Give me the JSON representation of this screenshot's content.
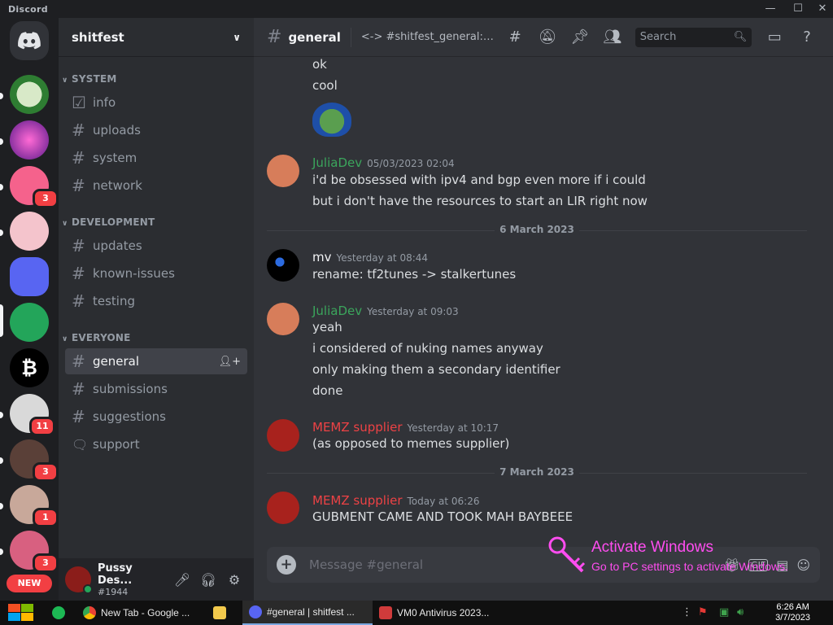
{
  "app": {
    "brand": "Discord"
  },
  "window_controls": {
    "minimize": "—",
    "maximize": "☐",
    "close": "✕"
  },
  "servers": {
    "badges": [
      {
        "server": "server-3",
        "count": "3"
      },
      {
        "server": "server-8",
        "count": "11"
      },
      {
        "server": "server-9",
        "count": "3"
      },
      {
        "server": "server-10",
        "count": "1"
      },
      {
        "server": "server-11",
        "count": "3"
      }
    ],
    "new_label": "NEW"
  },
  "guild": {
    "name": "shitfest"
  },
  "categories": [
    {
      "name": "SYSTEM",
      "channels": [
        {
          "name": "info",
          "icon": "rules-icon"
        },
        {
          "name": "uploads",
          "icon": "hash-icon"
        },
        {
          "name": "system",
          "icon": "hash-icon"
        },
        {
          "name": "network",
          "icon": "hash-icon"
        }
      ]
    },
    {
      "name": "DEVELOPMENT",
      "channels": [
        {
          "name": "updates",
          "icon": "hash-icon"
        },
        {
          "name": "known-issues",
          "icon": "hash-icon"
        },
        {
          "name": "testing",
          "icon": "hash-icon"
        }
      ]
    },
    {
      "name": "EVERYONE",
      "channels": [
        {
          "name": "general",
          "icon": "hash-icon",
          "selected": true
        },
        {
          "name": "submissions",
          "icon": "hash-icon"
        },
        {
          "name": "suggestions",
          "icon": "hash-icon"
        },
        {
          "name": "support",
          "icon": "forum-icon"
        }
      ]
    }
  ],
  "user": {
    "name": "Pussy Des...",
    "tag": "#1944"
  },
  "chat": {
    "channel": "general",
    "topic": "<-> #shitfest_general:cat...",
    "search_placeholder": "Search",
    "composer_placeholder": "Message #general",
    "messages": {
      "cont1": "ok",
      "cont2": "cool",
      "m1": {
        "author": "JuliaDev",
        "time": "05/03/2023 02:04",
        "lines": [
          "i'd be obsessed with ipv4 and bgp even more if i could",
          "but i don't have the resources to start an LIR right now"
        ]
      },
      "divider1": "6 March 2023",
      "m2": {
        "author": "mv",
        "time": "Yesterday at 08:44",
        "lines": [
          "rename: tf2tunes -> stalkertunes"
        ]
      },
      "m3": {
        "author": "JuliaDev",
        "time": "Yesterday at 09:03",
        "lines": [
          "yeah",
          "i considered of nuking names anyway",
          "only making them a secondary identifier",
          "done"
        ]
      },
      "m4": {
        "author": "MEMZ supplier",
        "time": "Yesterday at 10:17",
        "lines": [
          "(as opposed to memes supplier)"
        ]
      },
      "divider2": "7 March 2023",
      "m5": {
        "author": "MEMZ supplier",
        "time": "Today at 06:26",
        "lines": [
          "GUBMENT CAME AND TOOK MAH BAYBEEE"
        ]
      }
    }
  },
  "activation": {
    "title": "Activate Windows",
    "subtitle": "Go to PC settings to activate Windows."
  },
  "taskbar": {
    "items": [
      "New Tab - Google ...",
      "#general | shitfest ...",
      "VM0 Antivirus 2023..."
    ],
    "time": "6:26 AM",
    "date": "3/7/2023"
  },
  "colors": {
    "julia": "#3ba55c",
    "memz": "#ed4245",
    "mv": "#f2f3f5"
  }
}
